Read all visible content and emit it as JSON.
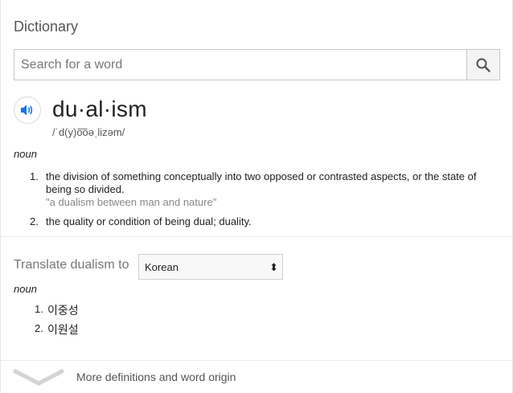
{
  "header": {
    "title": "Dictionary"
  },
  "search": {
    "placeholder": "Search for a word",
    "value": "",
    "button_icon": "search-icon"
  },
  "entry": {
    "headword": "du·al·ism",
    "phonetic": "/ˈd(y)o͞oəˌlizəm/",
    "speaker_icon": "volume-icon",
    "part_of_speech": "noun",
    "definitions": [
      {
        "number": "1.",
        "text": "the division of something conceptually into two opposed or contrasted aspects, or the state of being so divided.",
        "example": "\"a dualism between man and nature\""
      },
      {
        "number": "2.",
        "text": "the quality or condition of being dual; duality.",
        "example": ""
      }
    ]
  },
  "translate": {
    "label": "Translate dualism to",
    "selected_language": "Korean",
    "arrows_glyph": "⬍",
    "part_of_speech": "noun",
    "translations": [
      {
        "number": "1.",
        "text": "이중성"
      },
      {
        "number": "2.",
        "text": "이원설"
      }
    ]
  },
  "footer": {
    "more_label": "More definitions and word origin",
    "chevron_icon": "chevron-down-icon"
  },
  "colors": {
    "accent": "#1a73e8",
    "text": "#222222",
    "muted": "#777777",
    "example": "#888888"
  }
}
